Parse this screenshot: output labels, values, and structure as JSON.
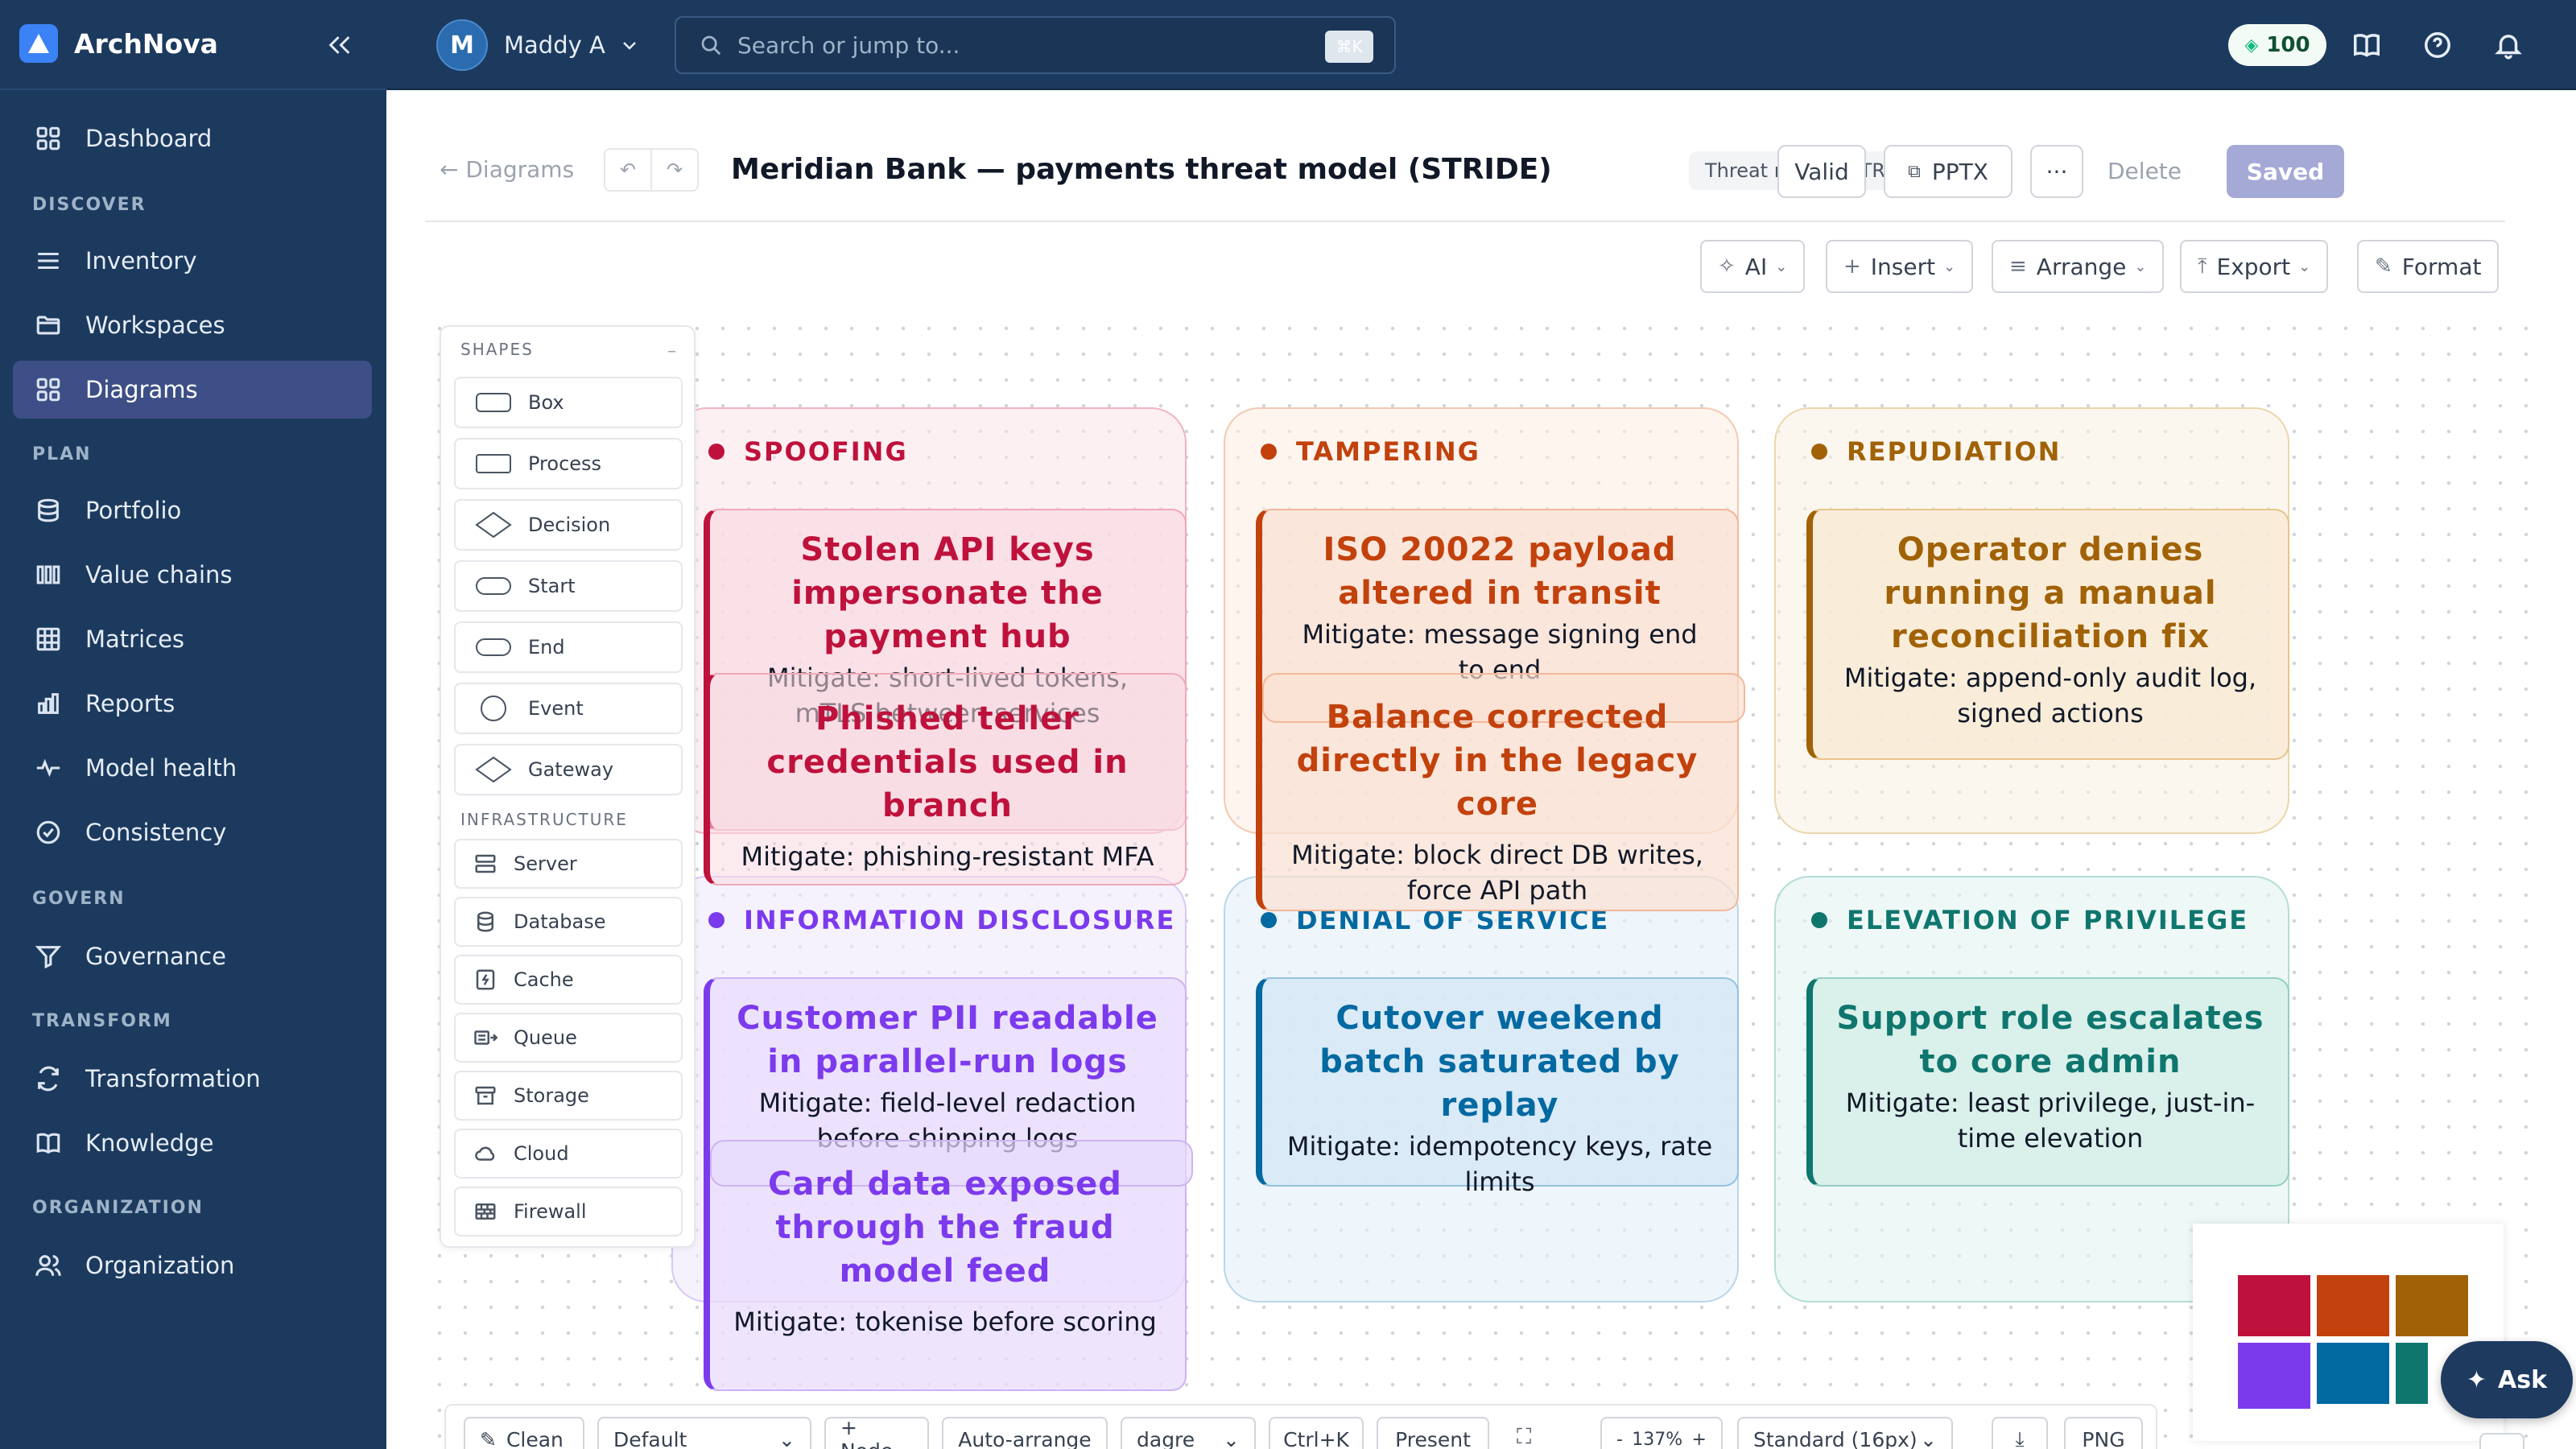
{
  "app": {
    "name": "ArchNova"
  },
  "sidebar": {
    "sections": {
      "discover": "DISCOVER",
      "plan": "PLAN",
      "govern": "GOVERN",
      "transform": "TRANSFORM",
      "organization": "ORGANIZATION"
    },
    "items": [
      {
        "label": "Dashboard",
        "icon": "grid-icon"
      },
      {
        "label": "Inventory",
        "icon": "list-icon"
      },
      {
        "label": "Workspaces",
        "icon": "folder-icon"
      },
      {
        "label": "Diagrams",
        "icon": "grid-icon",
        "active": true
      },
      {
        "label": "Portfolio",
        "icon": "database-icon"
      },
      {
        "label": "Value chains",
        "icon": "columns-icon"
      },
      {
        "label": "Matrices",
        "icon": "table-icon"
      },
      {
        "label": "Reports",
        "icon": "bar-chart-icon"
      },
      {
        "label": "Model health",
        "icon": "pulse-icon"
      },
      {
        "label": "Consistency",
        "icon": "check-circle-icon"
      },
      {
        "label": "Governance",
        "icon": "filter-icon"
      },
      {
        "label": "Transformation",
        "icon": "refresh-icon"
      },
      {
        "label": "Knowledge",
        "icon": "book-icon"
      },
      {
        "label": "Organization",
        "icon": "users-icon"
      }
    ]
  },
  "header": {
    "user": {
      "initial": "M",
      "name": "Maddy A"
    },
    "search": {
      "placeholder": "Search or jump to...",
      "shortcut": "⌘K"
    },
    "credits": "100"
  },
  "editor": {
    "back": "← Diagrams",
    "title": "Meridian Bank — payments threat model (STRIDE)",
    "type_badge": "Threat model (STRIDE)",
    "valid": "Valid",
    "pptx": "PPTX",
    "more": "···",
    "delete": "Delete",
    "saved": "Saved",
    "toolbar": {
      "ai": "AI",
      "insert": "Insert",
      "arrange": "Arrange",
      "export": "Export",
      "format": "Format"
    }
  },
  "palette": {
    "shapes_heading": "SHAPES",
    "infra_heading": "INFRASTRUCTURE",
    "shapes": [
      "Box",
      "Process",
      "Decision",
      "Start",
      "End",
      "Event",
      "Gateway"
    ],
    "infrastructure": [
      "Server",
      "Database",
      "Cache",
      "Queue",
      "Storage",
      "Cloud",
      "Firewall"
    ]
  },
  "zones": [
    {
      "label": "SPOOFING",
      "color": "#be123c"
    },
    {
      "label": "TAMPERING",
      "color": "#c2410c"
    },
    {
      "label": "REPUDIATION",
      "color": "#a16207"
    },
    {
      "label": "INFORMATION DISCLOSURE",
      "color": "#7c3aed"
    },
    {
      "label": "DENIAL OF SERVICE",
      "color": "#0369a1"
    },
    {
      "label": "ELEVATION OF PRIVILEGE",
      "color": "#0f766e"
    }
  ],
  "threats": [
    {
      "title": "Stolen API keys impersonate the payment hub",
      "mitigation": "Mitigate: short-lived tokens, mTLS between services"
    },
    {
      "title": "Phished teller credentials used in branch",
      "mitigation": "Mitigate: phishing-resistant MFA"
    },
    {
      "title": "ISO 20022 payload altered in transit",
      "mitigation": "Mitigate: message signing end to end"
    },
    {
      "title": "Balance corrected directly in the legacy core",
      "mitigation": "Mitigate: block direct DB writes, force API path"
    },
    {
      "title": "Operator denies running a manual reconciliation fix",
      "mitigation": "Mitigate: append-only audit log, signed actions"
    },
    {
      "title": "Customer PII readable in parallel-run logs",
      "mitigation": "Mitigate: field-level redaction before shipping logs"
    },
    {
      "title": "Card data exposed through the fraud model feed",
      "mitigation": "Mitigate: tokenise before scoring"
    },
    {
      "title": "Cutover weekend batch saturated by replay",
      "mitigation": "Mitigate: idempotency keys, rate limits"
    },
    {
      "title": "Support role escalates to core admin",
      "mitigation": "Mitigate: least privilege, just-in-time elevation"
    }
  ],
  "ask": "Ask",
  "bottombar": {
    "clean": "Clean",
    "style": "Default",
    "add_node": "+ Node",
    "auto_arrange": "Auto-arrange",
    "layout_engine": "dagre",
    "shortcut": "Ctrl+K",
    "present": "Present",
    "zoom": "137%",
    "zoom_minus": "-",
    "zoom_plus": "+",
    "grid": "Standard (16px)",
    "png": "PNG"
  }
}
